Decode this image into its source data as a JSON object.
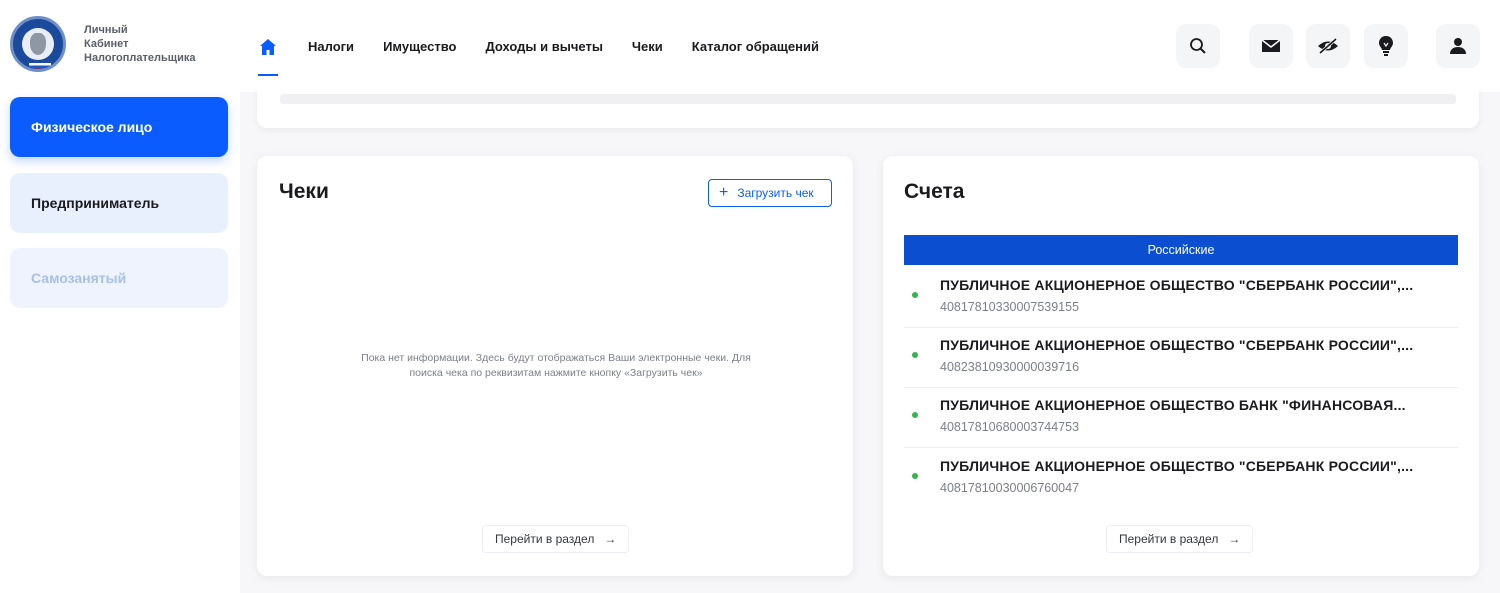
{
  "brand": {
    "line1": "Личный",
    "line2": "Кабинет",
    "line3": "Налогоплательщика",
    "logo_icon": "fns-emblem-icon"
  },
  "sidebar": {
    "items": [
      {
        "label": "Физическое лицо",
        "state": "active"
      },
      {
        "label": "Предприниматель",
        "state": "normal"
      },
      {
        "label": "Самозанятый",
        "state": "disabled"
      }
    ]
  },
  "nav": {
    "home_icon": "home-icon",
    "items": [
      "Налоги",
      "Имущество",
      "Доходы и вычеты",
      "Чеки",
      "Каталог обращений"
    ]
  },
  "header_icons": [
    "search-icon",
    "mail-icon",
    "eye-off-icon",
    "lightbulb-icon",
    "user-icon"
  ],
  "receipts": {
    "title": "Чеки",
    "upload_label": "Загрузить чек",
    "empty_line1": "Пока нет информации. Здесь будут отображаться Ваши электронные чеки. Для",
    "empty_line2": "поиска чека по реквизитам нажмите кнопку «Загрузить чек»",
    "goto_label": "Перейти в раздел"
  },
  "accounts": {
    "title": "Счета",
    "tab_label": "Российские",
    "items": [
      {
        "name": "ПУБЛИЧНОЕ АКЦИОНЕРНОЕ ОБЩЕСТВО \"СБЕРБАНК РОССИИ\",...",
        "number": "40817810330007539155"
      },
      {
        "name": "ПУБЛИЧНОЕ АКЦИОНЕРНОЕ ОБЩЕСТВО \"СБЕРБАНК РОССИИ\",...",
        "number": "40823810930000039716"
      },
      {
        "name": "ПУБЛИЧНОЕ АКЦИОНЕРНОЕ ОБЩЕСТВО БАНК \"ФИНАНСОВАЯ...",
        "number": "40817810680003744753"
      },
      {
        "name": "ПУБЛИЧНОЕ АКЦИОНЕРНОЕ ОБЩЕСТВО \"СБЕРБАНК РОССИИ\",...",
        "number": "40817810030006760047"
      }
    ],
    "goto_label": "Перейти в раздел"
  },
  "colors": {
    "accent": "#0a5cff",
    "tab": "#0b4fd0",
    "status_green": "#35b450"
  }
}
